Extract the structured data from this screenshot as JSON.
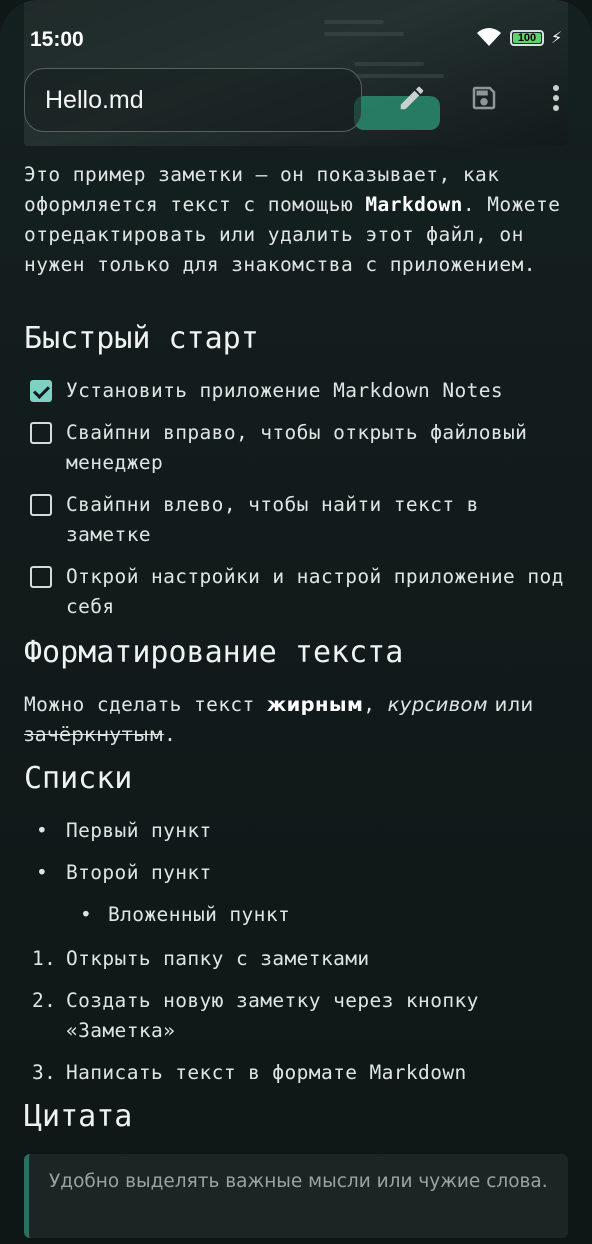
{
  "status": {
    "time": "15:00",
    "battery": "100"
  },
  "toolbar": {
    "filename": "Hello.md",
    "icons": [
      "pencil-icon",
      "save-icon",
      "more-vert-icon"
    ]
  },
  "note": {
    "intro_a": "Это пример заметки — он показывает, как оформляется текст с помощью ",
    "intro_bold": "Markdown",
    "intro_b": ". Можете отредактировать или удалить этот файл, он нужен только для знакомства с приложением.",
    "quick_heading": "Быстрый старт",
    "tasks": [
      {
        "text": "Установить приложение Markdown Notes",
        "checked": true
      },
      {
        "text": "Свайпни вправо, чтобы открыть файловый менеджер",
        "checked": false
      },
      {
        "text": "Свайпни влево, чтобы найти текст в заметке",
        "checked": false
      },
      {
        "text": "Открой настройки и настрой приложение под себя",
        "checked": false
      }
    ],
    "format_heading": "Форматирование текста",
    "format_a": "Можно сделать текст ",
    "format_bold": "жирным",
    "format_comma": ", ",
    "format_italic": "курсивом",
    "format_or": " или",
    "format_strike": "зачёркнутым",
    "format_end": ".",
    "lists_heading": "Списки",
    "bullets": [
      "Первый пункт",
      "Второй пункт"
    ],
    "nested_bullet": "Вложенный пункт",
    "ordered": [
      {
        "num": "1.",
        "text": "Открыть папку с заметками"
      },
      {
        "num": "2.",
        "text": "Создать новую заметку через кнопку «Заметка»"
      },
      {
        "num": "3.",
        "text": "Написать текст в формате Markdown"
      }
    ],
    "quote_heading": "Цитата",
    "quote": "Удобно выделять важные мысли или чужие слова."
  },
  "colors": {
    "accent": "#7fd2c2",
    "quote_bar": "#2f6f63",
    "background": "#121b1b"
  }
}
